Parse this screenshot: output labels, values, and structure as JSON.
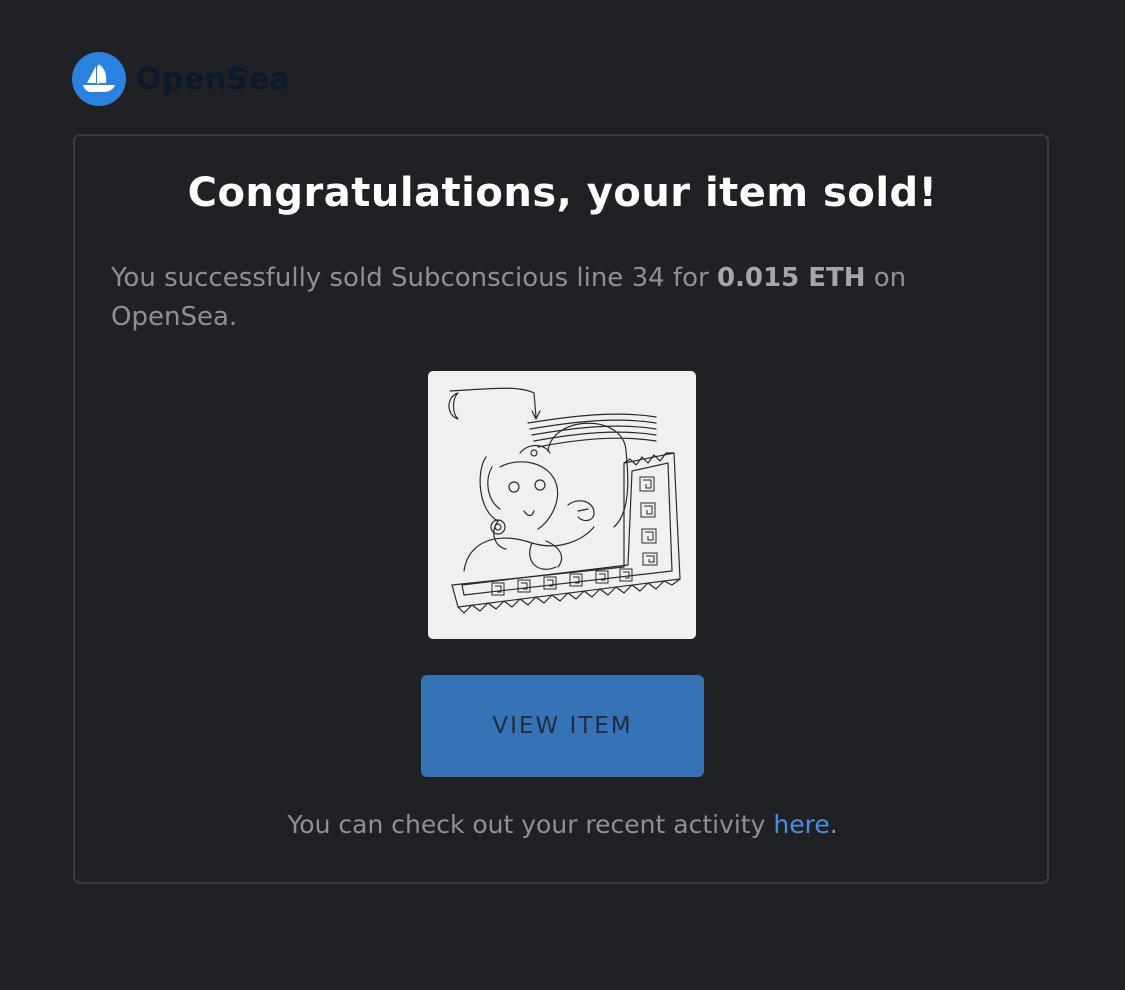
{
  "brand": {
    "name": "OpenSea",
    "logo_icon": "opensea-boat-icon",
    "logo_color": "#2a81e0"
  },
  "email": {
    "headline": "Congratulations, your item sold!",
    "message_prefix": "You successfully sold Subconscious line 34 for ",
    "price": "0.015 ETH",
    "message_suffix": " on OpenSea.",
    "item_image_alt": "line drawing artwork",
    "view_button_label": "VIEW ITEM",
    "footer_prefix": "You can check out your recent activity ",
    "footer_link_label": "here",
    "footer_suffix": "."
  },
  "colors": {
    "background": "#202125",
    "card_border": "#3a3b40",
    "button": "#3572b6",
    "link": "#4e8ed8"
  }
}
